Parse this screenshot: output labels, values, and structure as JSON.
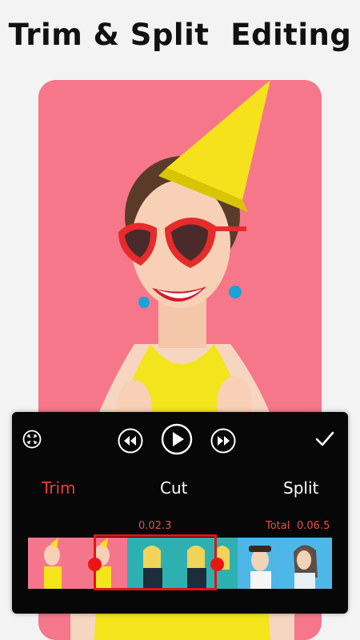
{
  "headline": "Trim & Split  Editing",
  "icons": {
    "expand": "expand-arrows-icon",
    "rewind": "rewind-icon",
    "play": "play-icon",
    "fast_forward": "fast-forward-icon",
    "confirm": "checkmark-icon"
  },
  "tabs": [
    {
      "label": "Trim",
      "active": true
    },
    {
      "label": "Cut",
      "active": false
    },
    {
      "label": "Split",
      "active": false
    }
  ],
  "timeline": {
    "current_time": "0.02.3",
    "total_label": "Total",
    "total_time": "0.06.5"
  },
  "colors": {
    "accent": "#f23a3a",
    "panel": "#070707",
    "photo_bg": "#f6768a",
    "dress": "#f4e41c"
  }
}
